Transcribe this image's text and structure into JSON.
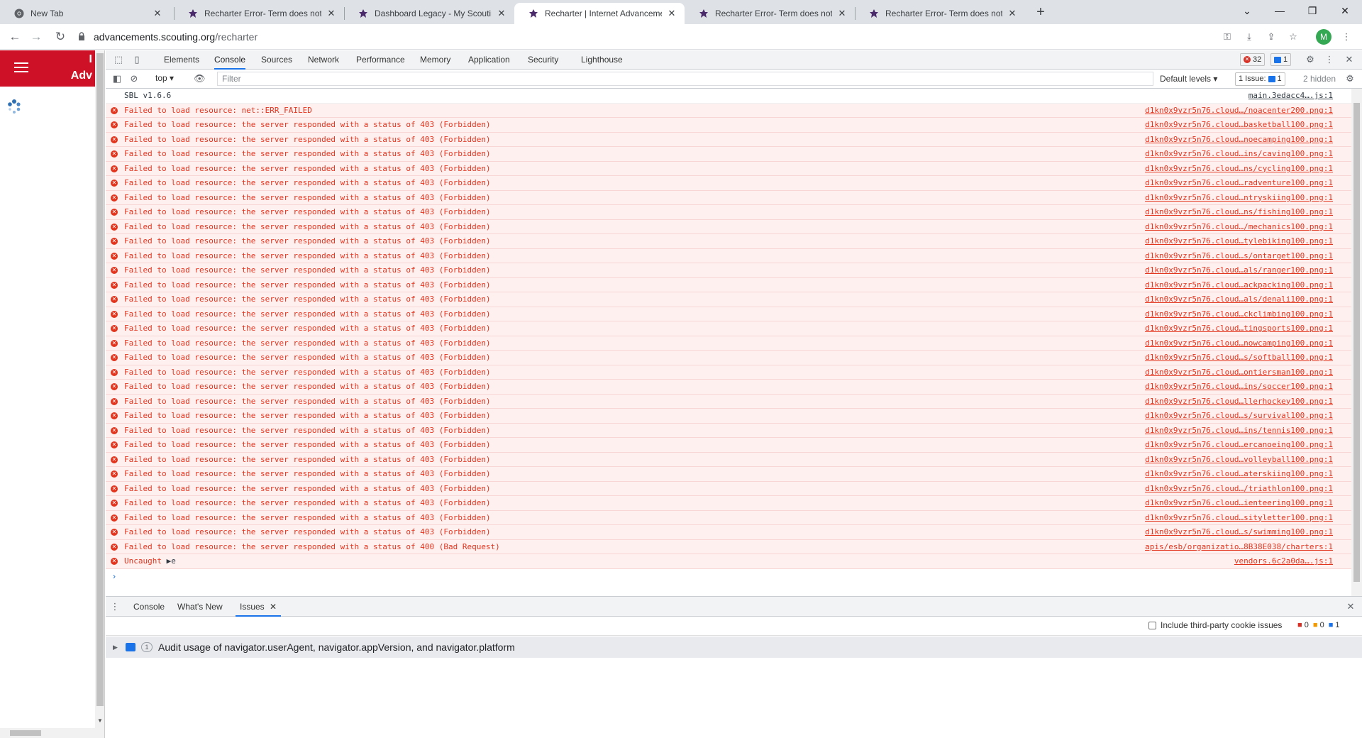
{
  "browser": {
    "tabs": [
      {
        "title": "New Tab",
        "active": false
      },
      {
        "title": "Recharter Error- Term does not m",
        "active": false
      },
      {
        "title": "Dashboard Legacy - My Scouting",
        "active": false
      },
      {
        "title": "Recharter | Internet Advancemen",
        "active": true
      },
      {
        "title": "Recharter Error- Term does not m",
        "active": false
      },
      {
        "title": "Recharter Error- Term does not m",
        "active": false
      }
    ],
    "url_host": "advancements.scouting.org",
    "url_path": "/recharter",
    "avatar_letter": "M"
  },
  "page": {
    "brand_line1": "I",
    "brand_line2": "Adv"
  },
  "devtools": {
    "tabs": [
      "Elements",
      "Console",
      "Sources",
      "Network",
      "Performance",
      "Memory",
      "Application",
      "Security",
      "Lighthouse"
    ],
    "active_tab": "Console",
    "error_count": "32",
    "message_count": "1",
    "context": "top",
    "filter_placeholder": "Filter",
    "default_levels": "Default levels",
    "issues_label": "1 Issue:",
    "issues_count": "1",
    "hidden_label": "2 hidden",
    "console": [
      {
        "type": "info",
        "msg": "SBL v1.6.6",
        "src": "main.3edacc4….js:1"
      },
      {
        "type": "error",
        "msg": "Failed to load resource: net::ERR_FAILED",
        "src": "d1kn0x9vzr5n76.cloud…/noacenter200.png:1"
      },
      {
        "type": "error",
        "msg": "Failed to load resource: the server responded with a status of 403 (Forbidden)",
        "src": "d1kn0x9vzr5n76.cloud…basketball100.png:1"
      },
      {
        "type": "error",
        "msg": "Failed to load resource: the server responded with a status of 403 (Forbidden)",
        "src": "d1kn0x9vzr5n76.cloud…noecamping100.png:1"
      },
      {
        "type": "error",
        "msg": "Failed to load resource: the server responded with a status of 403 (Forbidden)",
        "src": "d1kn0x9vzr5n76.cloud…ins/caving100.png:1"
      },
      {
        "type": "error",
        "msg": "Failed to load resource: the server responded with a status of 403 (Forbidden)",
        "src": "d1kn0x9vzr5n76.cloud…ns/cycling100.png:1"
      },
      {
        "type": "error",
        "msg": "Failed to load resource: the server responded with a status of 403 (Forbidden)",
        "src": "d1kn0x9vzr5n76.cloud…radventure100.png:1"
      },
      {
        "type": "error",
        "msg": "Failed to load resource: the server responded with a status of 403 (Forbidden)",
        "src": "d1kn0x9vzr5n76.cloud…ntryskiing100.png:1"
      },
      {
        "type": "error",
        "msg": "Failed to load resource: the server responded with a status of 403 (Forbidden)",
        "src": "d1kn0x9vzr5n76.cloud…ns/fishing100.png:1"
      },
      {
        "type": "error",
        "msg": "Failed to load resource: the server responded with a status of 403 (Forbidden)",
        "src": "d1kn0x9vzr5n76.cloud…/mechanics100.png:1"
      },
      {
        "type": "error",
        "msg": "Failed to load resource: the server responded with a status of 403 (Forbidden)",
        "src": "d1kn0x9vzr5n76.cloud…tylebiking100.png:1"
      },
      {
        "type": "error",
        "msg": "Failed to load resource: the server responded with a status of 403 (Forbidden)",
        "src": "d1kn0x9vzr5n76.cloud…s/ontarget100.png:1"
      },
      {
        "type": "error",
        "msg": "Failed to load resource: the server responded with a status of 403 (Forbidden)",
        "src": "d1kn0x9vzr5n76.cloud…als/ranger100.png:1"
      },
      {
        "type": "error",
        "msg": "Failed to load resource: the server responded with a status of 403 (Forbidden)",
        "src": "d1kn0x9vzr5n76.cloud…ackpacking100.png:1"
      },
      {
        "type": "error",
        "msg": "Failed to load resource: the server responded with a status of 403 (Forbidden)",
        "src": "d1kn0x9vzr5n76.cloud…als/denali100.png:1"
      },
      {
        "type": "error",
        "msg": "Failed to load resource: the server responded with a status of 403 (Forbidden)",
        "src": "d1kn0x9vzr5n76.cloud…ckclimbing100.png:1"
      },
      {
        "type": "error",
        "msg": "Failed to load resource: the server responded with a status of 403 (Forbidden)",
        "src": "d1kn0x9vzr5n76.cloud…tingsports100.png:1"
      },
      {
        "type": "error",
        "msg": "Failed to load resource: the server responded with a status of 403 (Forbidden)",
        "src": "d1kn0x9vzr5n76.cloud…nowcamping100.png:1"
      },
      {
        "type": "error",
        "msg": "Failed to load resource: the server responded with a status of 403 (Forbidden)",
        "src": "d1kn0x9vzr5n76.cloud…s/softball100.png:1"
      },
      {
        "type": "error",
        "msg": "Failed to load resource: the server responded with a status of 403 (Forbidden)",
        "src": "d1kn0x9vzr5n76.cloud…ontiersman100.png:1"
      },
      {
        "type": "error",
        "msg": "Failed to load resource: the server responded with a status of 403 (Forbidden)",
        "src": "d1kn0x9vzr5n76.cloud…ins/soccer100.png:1"
      },
      {
        "type": "error",
        "msg": "Failed to load resource: the server responded with a status of 403 (Forbidden)",
        "src": "d1kn0x9vzr5n76.cloud…llerhockey100.png:1"
      },
      {
        "type": "error",
        "msg": "Failed to load resource: the server responded with a status of 403 (Forbidden)",
        "src": "d1kn0x9vzr5n76.cloud…s/survival100.png:1"
      },
      {
        "type": "error",
        "msg": "Failed to load resource: the server responded with a status of 403 (Forbidden)",
        "src": "d1kn0x9vzr5n76.cloud…ins/tennis100.png:1"
      },
      {
        "type": "error",
        "msg": "Failed to load resource: the server responded with a status of 403 (Forbidden)",
        "src": "d1kn0x9vzr5n76.cloud…ercanoeing100.png:1"
      },
      {
        "type": "error",
        "msg": "Failed to load resource: the server responded with a status of 403 (Forbidden)",
        "src": "d1kn0x9vzr5n76.cloud…volleyball100.png:1"
      },
      {
        "type": "error",
        "msg": "Failed to load resource: the server responded with a status of 403 (Forbidden)",
        "src": "d1kn0x9vzr5n76.cloud…aterskiing100.png:1"
      },
      {
        "type": "error",
        "msg": "Failed to load resource: the server responded with a status of 403 (Forbidden)",
        "src": "d1kn0x9vzr5n76.cloud…/triathlon100.png:1"
      },
      {
        "type": "error",
        "msg": "Failed to load resource: the server responded with a status of 403 (Forbidden)",
        "src": "d1kn0x9vzr5n76.cloud…ienteering100.png:1"
      },
      {
        "type": "error",
        "msg": "Failed to load resource: the server responded with a status of 403 (Forbidden)",
        "src": "d1kn0x9vzr5n76.cloud…sityletter100.png:1"
      },
      {
        "type": "error",
        "msg": "Failed to load resource: the server responded with a status of 403 (Forbidden)",
        "src": "d1kn0x9vzr5n76.cloud…s/swimming100.png:1"
      },
      {
        "type": "error",
        "msg": "Failed to load resource: the server responded with a status of 400 (Bad Request)",
        "src": "apis/esb/organizatio…8B38E038/charters:1"
      },
      {
        "type": "uncaught",
        "msg": "Uncaught",
        "obj": "e",
        "src": "vendors.6c2a0da….js:1"
      }
    ],
    "drawer": {
      "tabs": [
        "Console",
        "What's New",
        "Issues"
      ],
      "active_tab": "Issues",
      "third_party_label": "Include third-party cookie issues",
      "count_errors": "0",
      "count_warnings": "0",
      "count_info": "1",
      "issue_count": "1",
      "issue_text": "Audit usage of navigator.userAgent, navigator.appVersion, and navigator.platform"
    }
  },
  "colors": {
    "brand_red": "#ce1126",
    "error_text": "#e3341d",
    "error_bg": "#fff0f0",
    "accent_blue": "#1a73e8"
  }
}
